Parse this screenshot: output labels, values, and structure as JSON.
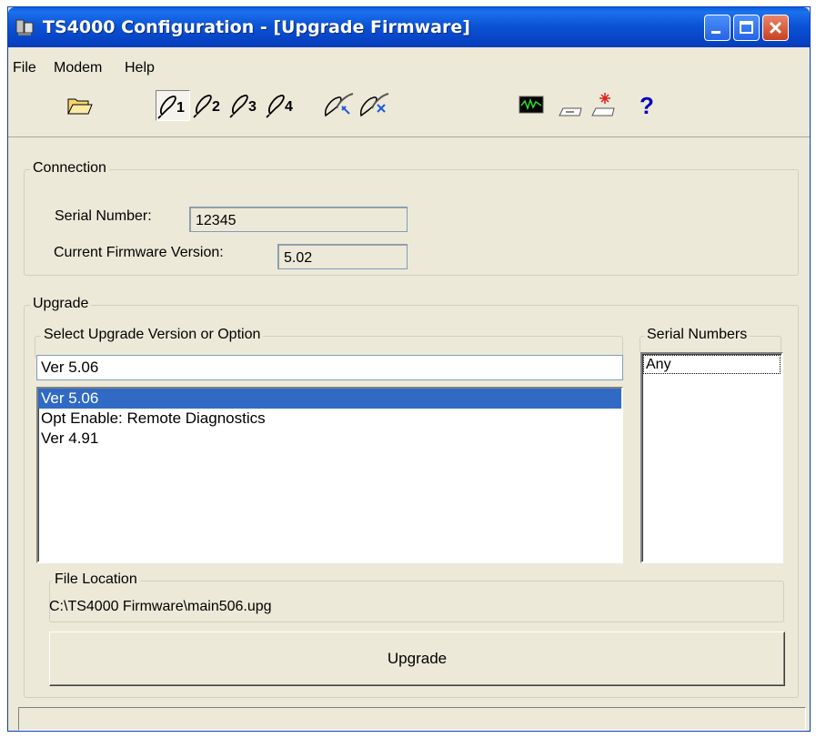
{
  "window": {
    "title": "TS4000 Configuration - [Upgrade Firmware]"
  },
  "menu": {
    "items": [
      "File",
      "Modem",
      "Help"
    ]
  },
  "toolbar": {
    "icons": [
      "open-folder-icon",
      "profile-1-icon",
      "profile-2-icon",
      "profile-3-icon",
      "profile-4-icon",
      "connect-icon",
      "disconnect-icon",
      "monitor-icon",
      "modem-icon",
      "reset-modem-icon",
      "help-icon"
    ],
    "profile_labels": [
      "1",
      "2",
      "3",
      "4"
    ],
    "help_label": "?"
  },
  "connection": {
    "legend": "Connection",
    "serial_label": "Serial Number:",
    "serial_value": "12345",
    "firmware_label": "Current Firmware Version:",
    "firmware_value": "5.02"
  },
  "upgrade": {
    "legend": "Upgrade",
    "select_legend": "Select Upgrade Version or Option",
    "selected_value": "Ver 5.06",
    "options": [
      "Ver 5.06",
      "Opt Enable: Remote Diagnostics",
      "Ver 4.91"
    ],
    "selected_index": 0,
    "serial_legend": "Serial Numbers",
    "serial_items": [
      "Any"
    ],
    "file_legend": "File Location",
    "file_path": "C:\\TS4000 Firmware\\main506.upg",
    "button_label": "Upgrade"
  },
  "colors": {
    "selection": "#316ac5",
    "title_bar": "#0a5fe0",
    "face": "#ece9d8"
  }
}
